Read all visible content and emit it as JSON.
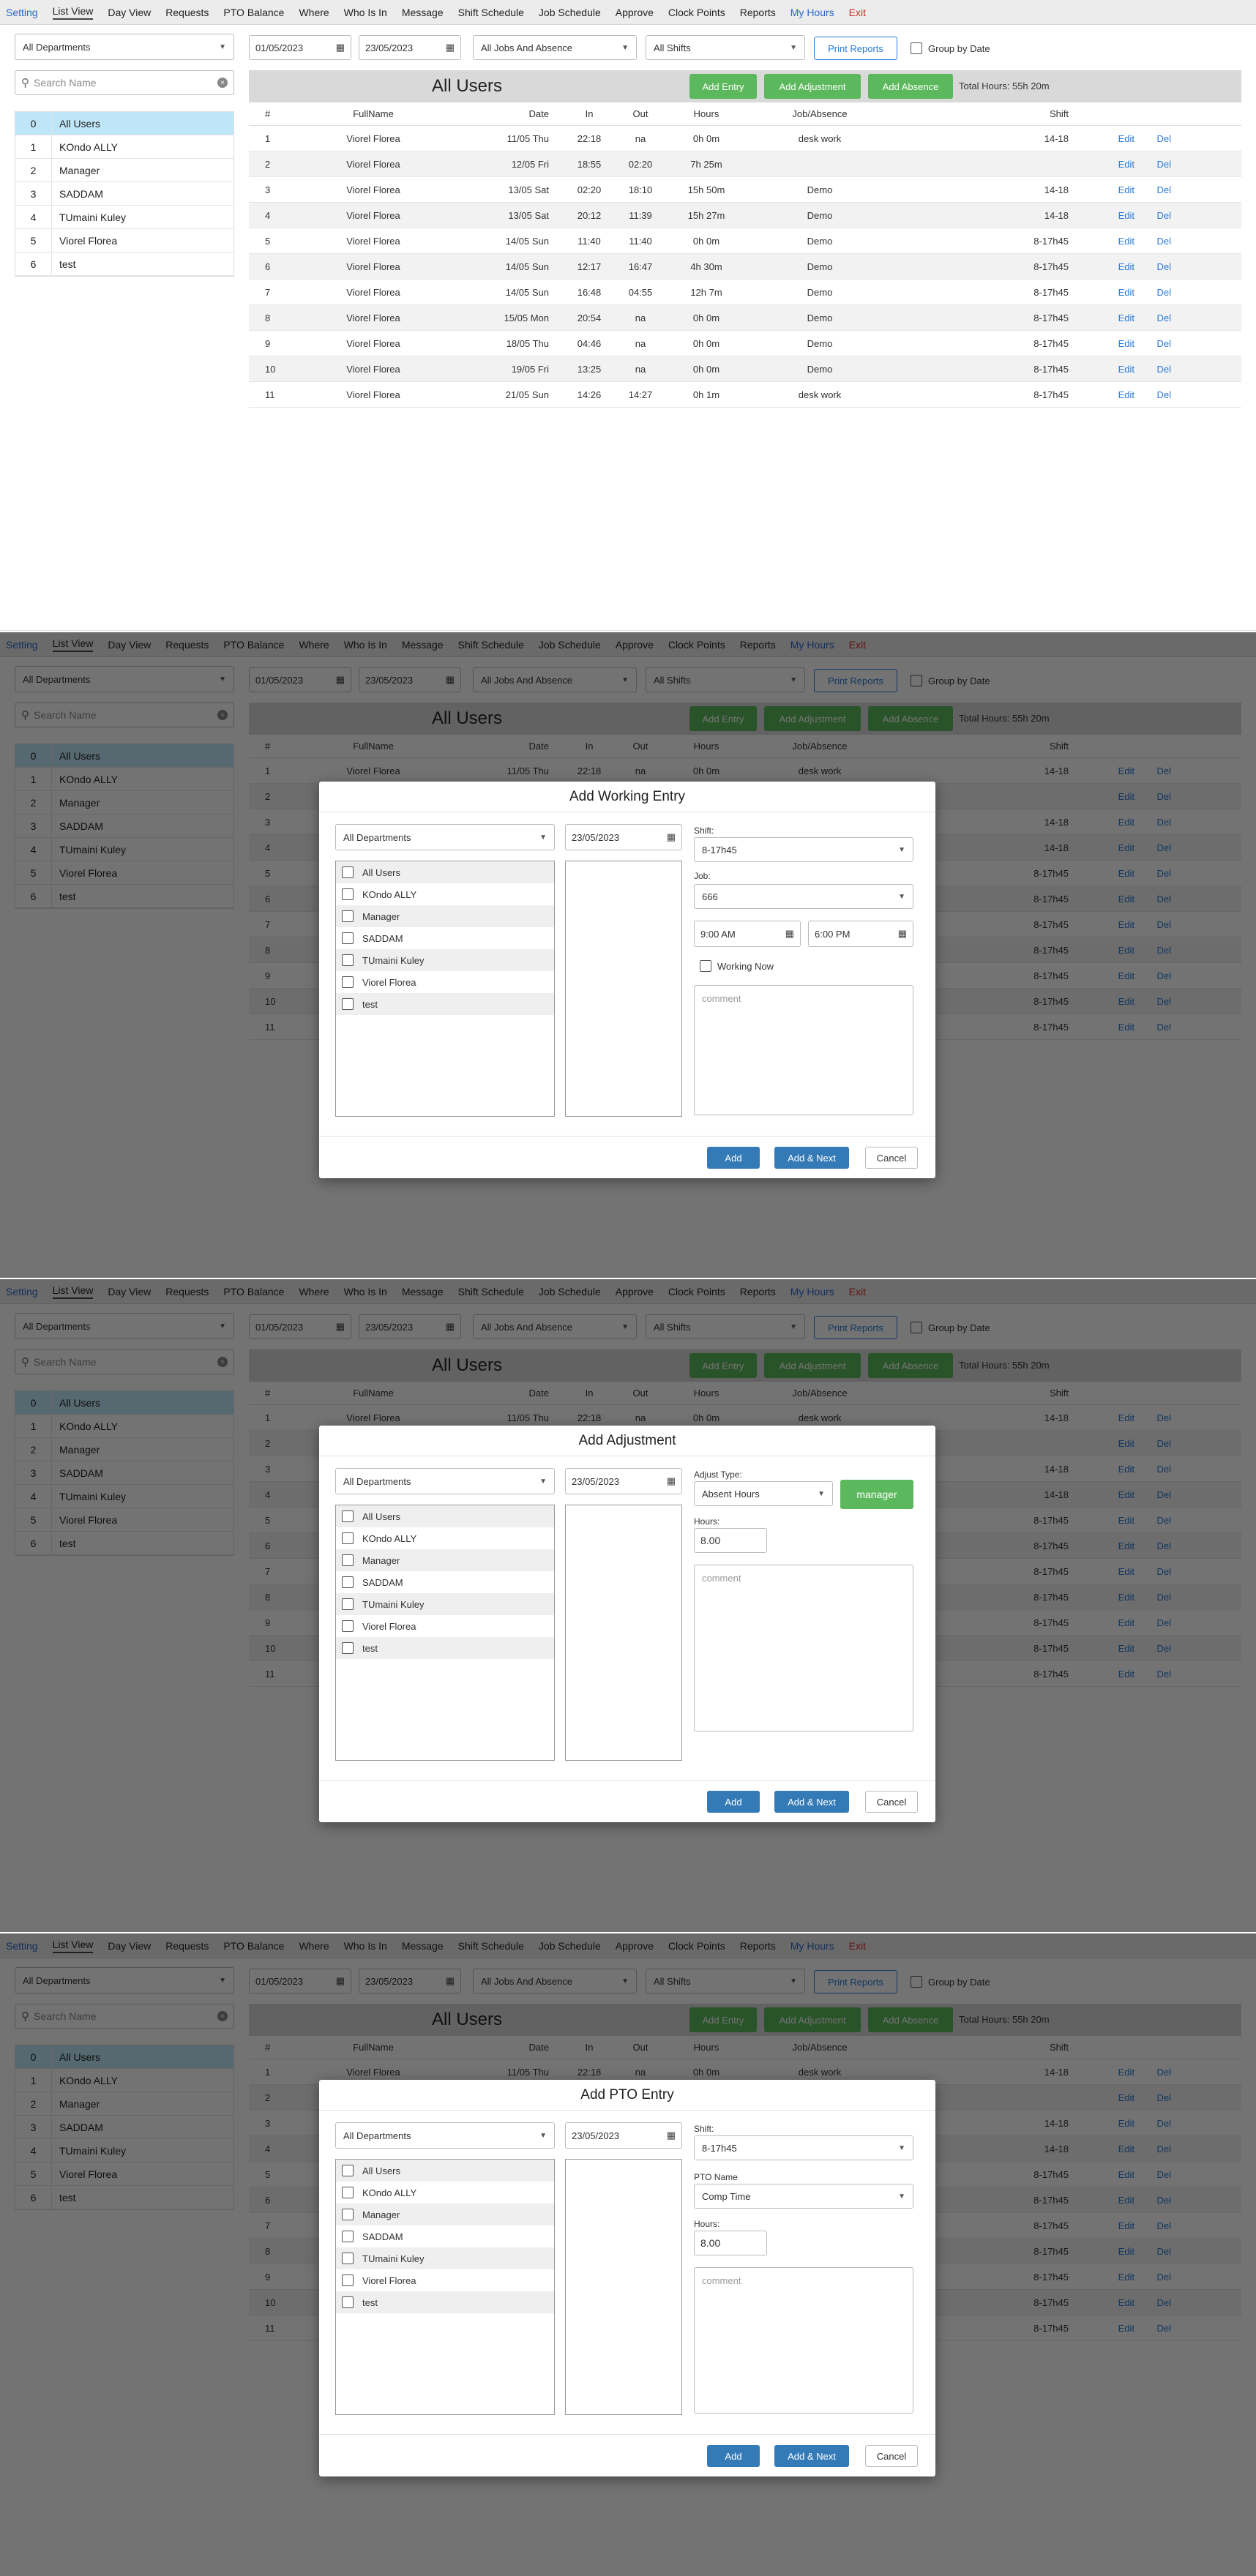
{
  "nav": [
    "Setting",
    "List View",
    "Day View",
    "Requests",
    "PTO Balance",
    "Where",
    "Who Is In",
    "Message",
    "Shift Schedule",
    "Job Schedule",
    "Approve",
    "Clock Points",
    "Reports",
    "My Hours",
    "Exit"
  ],
  "filters": {
    "department": "All Departments",
    "date_from": "01/05/2023",
    "date_to": "23/05/2023",
    "jobs": "All Jobs And Absence",
    "shifts": "All Shifts",
    "print_reports": "Print Reports",
    "group_by_date": "Group by Date"
  },
  "search_placeholder": "Search Name",
  "users": [
    {
      "n": "0",
      "name": "All Users"
    },
    {
      "n": "1",
      "name": "KOndo ALLY"
    },
    {
      "n": "2",
      "name": "Manager"
    },
    {
      "n": "3",
      "name": "SADDAM"
    },
    {
      "n": "4",
      "name": "TUmaini Kuley"
    },
    {
      "n": "5",
      "name": "Viorel Florea"
    },
    {
      "n": "6",
      "name": "test"
    }
  ],
  "header": {
    "title": "All Users",
    "add_entry": "Add Entry",
    "add_adjustment": "Add Adjustment",
    "add_absence": "Add Absence",
    "total_hours": "Total Hours: 55h 20m"
  },
  "columns": {
    "num": "#",
    "name": "FullName",
    "date": "Date",
    "in": "In",
    "out": "Out",
    "hours": "Hours",
    "job": "Job/Absence",
    "shift": "Shift"
  },
  "rows": [
    {
      "num": "1",
      "name": "Viorel Florea",
      "date": "11/05 Thu",
      "in": "22:18",
      "out": "na",
      "hours": "0h 0m",
      "job": "desk work",
      "shift": "14-18"
    },
    {
      "num": "2",
      "name": "Viorel Florea",
      "date": "12/05 Fri",
      "in": "18:55",
      "out": "02:20",
      "hours": "7h 25m",
      "job": "",
      "shift": ""
    },
    {
      "num": "3",
      "name": "Viorel Florea",
      "date": "13/05 Sat",
      "in": "02:20",
      "out": "18:10",
      "hours": "15h 50m",
      "job": "Demo",
      "shift": "14-18"
    },
    {
      "num": "4",
      "name": "Viorel Florea",
      "date": "13/05 Sat",
      "in": "20:12",
      "out": "11:39",
      "hours": "15h 27m",
      "job": "Demo",
      "shift": "14-18"
    },
    {
      "num": "5",
      "name": "Viorel Florea",
      "date": "14/05 Sun",
      "in": "11:40",
      "out": "11:40",
      "hours": "0h 0m",
      "job": "Demo",
      "shift": "8-17h45"
    },
    {
      "num": "6",
      "name": "Viorel Florea",
      "date": "14/05 Sun",
      "in": "12:17",
      "out": "16:47",
      "hours": "4h 30m",
      "job": "Demo",
      "shift": "8-17h45"
    },
    {
      "num": "7",
      "name": "Viorel Florea",
      "date": "14/05 Sun",
      "in": "16:48",
      "out": "04:55",
      "hours": "12h 7m",
      "job": "Demo",
      "shift": "8-17h45"
    },
    {
      "num": "8",
      "name": "Viorel Florea",
      "date": "15/05 Mon",
      "in": "20:54",
      "out": "na",
      "hours": "0h 0m",
      "job": "Demo",
      "shift": "8-17h45"
    },
    {
      "num": "9",
      "name": "Viorel Florea",
      "date": "18/05 Thu",
      "in": "04:46",
      "out": "na",
      "hours": "0h 0m",
      "job": "Demo",
      "shift": "8-17h45"
    },
    {
      "num": "10",
      "name": "Viorel Florea",
      "date": "19/05 Fri",
      "in": "13:25",
      "out": "na",
      "hours": "0h 0m",
      "job": "Demo",
      "shift": "8-17h45"
    },
    {
      "num": "11",
      "name": "Viorel Florea",
      "date": "21/05 Sun",
      "in": "14:26",
      "out": "14:27",
      "hours": "0h 1m",
      "job": "desk work",
      "shift": "8-17h45"
    }
  ],
  "row_actions": {
    "edit": "Edit",
    "del": "Del"
  },
  "modal_common": {
    "department": "All Departments",
    "date": "23/05/2023",
    "comment_placeholder": "comment",
    "add": "Add",
    "add_next": "Add & Next",
    "cancel": "Cancel"
  },
  "modal_entry": {
    "title": "Add Working Entry",
    "shift_label": "Shift:",
    "shift": "8-17h45",
    "job_label": "Job:",
    "job": "666",
    "time_from": "9:00 AM",
    "time_to": "6:00 PM",
    "working_now": "Working Now"
  },
  "modal_adjust": {
    "title": "Add Adjustment",
    "adjust_type_label": "Adjust Type:",
    "adjust_type": "Absent Hours",
    "manager_btn": "manager",
    "hours_label": "Hours:",
    "hours": "8.00"
  },
  "modal_pto": {
    "title": "Add PTO Entry",
    "shift_label": "Shift:",
    "shift": "8-17h45",
    "pto_label": "PTO Name",
    "pto": "Comp Time",
    "hours_label": "Hours:",
    "hours": "8.00"
  }
}
